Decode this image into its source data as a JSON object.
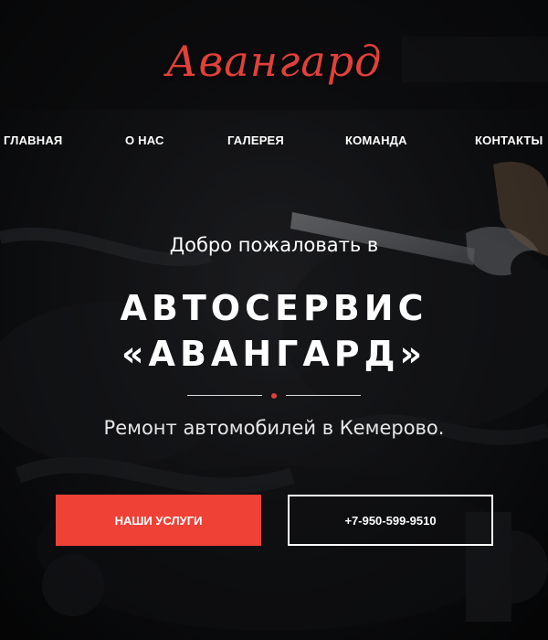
{
  "brand": {
    "logo_text": "Авангард",
    "accent_color": "#ef4136"
  },
  "nav": {
    "items": [
      {
        "label": "ГЛАВНАЯ"
      },
      {
        "label": "О НАС"
      },
      {
        "label": "ГАЛЕРЕЯ"
      },
      {
        "label": "КОМАНДА"
      },
      {
        "label": "КОНТАКТЫ"
      }
    ]
  },
  "hero": {
    "welcome": "Добро пожаловать в",
    "title_line1": "АВТОСЕРВИС",
    "title_line2": "«АВАНГАРД»",
    "tagline": "Ремонт автомобилей в Кемерово.",
    "primary_button": "НАШИ УСЛУГИ",
    "phone_button": "+7-950-599-9510"
  }
}
